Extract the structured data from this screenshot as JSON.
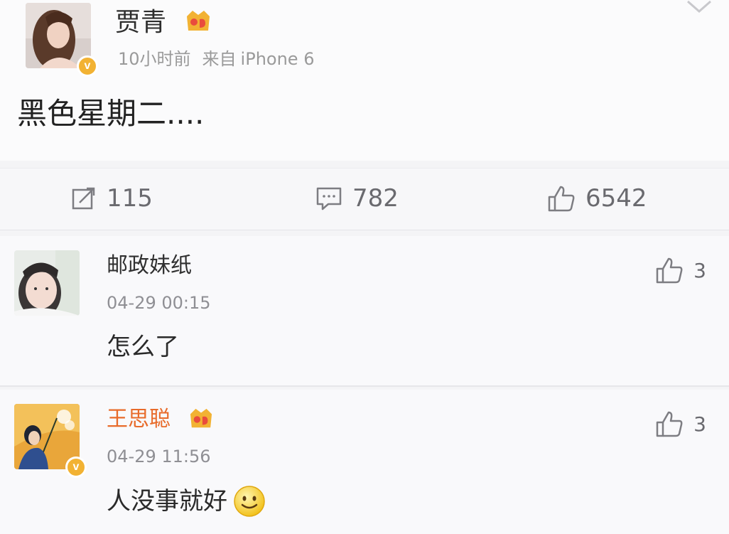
{
  "post": {
    "author": "贾青",
    "time": "10小时前",
    "source_prefix": "来自",
    "source_device": "iPhone 6",
    "text": "黑色星期二....",
    "icons": [
      "verified-badge-icon",
      "vip-crown-icon",
      "chevron-down-icon"
    ]
  },
  "actions": {
    "repost_count": "115",
    "comment_count": "782",
    "like_count": "6542",
    "icons": [
      "repost-icon",
      "comment-icon",
      "like-icon"
    ]
  },
  "comments": [
    {
      "author": "邮政妹纸",
      "time": "04-29 00:15",
      "text": "怎么了",
      "likes": "3",
      "verified": false
    },
    {
      "author": "王思聪",
      "time": "04-29 11:56",
      "text": "人没事就好",
      "likes": "3",
      "verified": true,
      "emoji": "smiley-emoji-icon"
    }
  ],
  "colors": {
    "vip_gold": "#f2b233",
    "highlight_name": "#e86b2a",
    "meta_gray": "#9a9a9a",
    "icon_gray": "#6a6a6f"
  }
}
